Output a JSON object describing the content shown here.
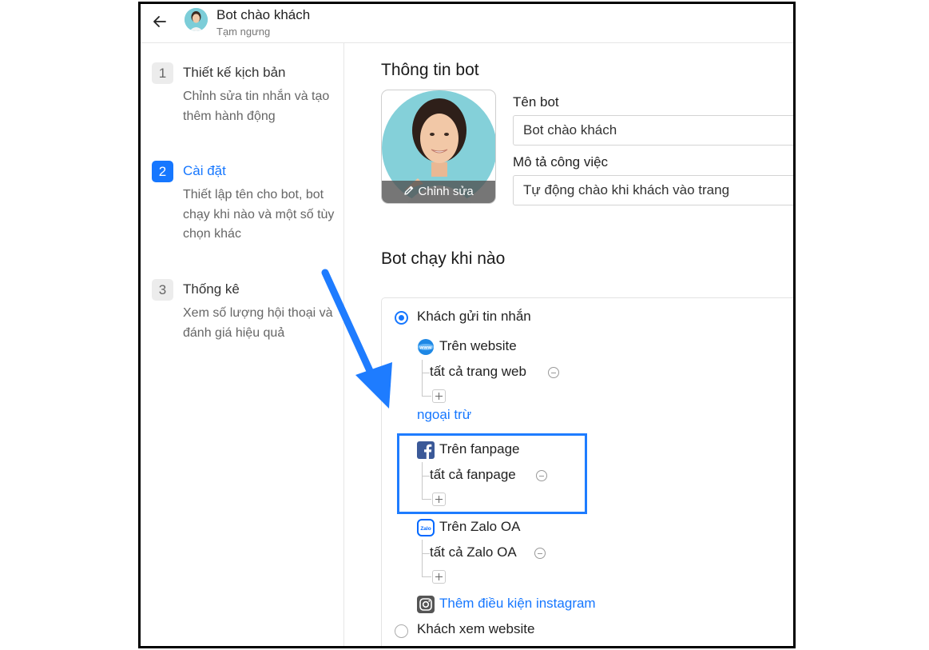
{
  "header": {
    "title": "Bot chào khách",
    "status": "Tạm ngưng"
  },
  "steps": [
    {
      "num": "1",
      "title": "Thiết kế kịch bản",
      "desc": "Chỉnh sửa tin nhắn và tạo thêm hành động",
      "active": false
    },
    {
      "num": "2",
      "title": "Cài đặt",
      "desc": "Thiết lập tên cho bot, bot chạy khi nào và một số tùy chọn khác",
      "active": true
    },
    {
      "num": "3",
      "title": "Thống kê",
      "desc": "Xem số lượng hội thoại và đánh giá hiệu quả",
      "active": false
    }
  ],
  "info": {
    "title": "Thông tin bot",
    "edit_photo": "Chỉnh sửa",
    "name_label": "Tên bot",
    "name_value": "Bot chào khách",
    "desc_label": "Mô tả công việc",
    "desc_value": "Tự động chào khi khách vào trang"
  },
  "triggers": {
    "title": "Bot chạy khi nào",
    "option_message": "Khách gửi tin nhắn",
    "option_message_selected": true,
    "website": {
      "label": "Trên website",
      "condition": "tất cả trang web",
      "except": "ngoại trừ"
    },
    "fanpage": {
      "label": "Trên fanpage",
      "condition": "tất cả fanpage"
    },
    "zalo": {
      "label": "Trên Zalo OA",
      "condition": "tất cả Zalo OA"
    },
    "instagram_link": "Thêm điều kiện instagram",
    "option_view": "Khách xem website",
    "option_view_selected": false
  },
  "colors": {
    "accent": "#1677ff",
    "highlight": "#1e7cff",
    "facebook": "#3b5998",
    "zalo": "#0068ff"
  }
}
